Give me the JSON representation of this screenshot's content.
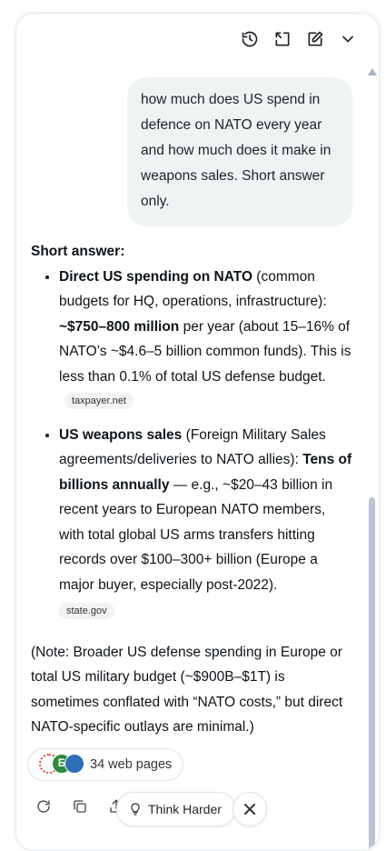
{
  "user_message": "how much does US spend in defence on NATO every year and how much does it make in weapons sales. Short answer only.",
  "answer": {
    "heading": "Short answer:",
    "items": [
      {
        "title": "Direct US spending on NATO",
        "desc": " (common budgets for HQ, operations, infrastructure): ",
        "highlight": "~$750–800 million",
        "rest": " per year (about 15–16% of NATO’s ~$4.6–5 billion common funds). This is less than 0.1% of total US defense budget.",
        "source": "taxpayer.net"
      },
      {
        "title": "US weapons sales",
        "desc": " (Foreign Military Sales agreements/deliveries to NATO allies): ",
        "highlight": "Tens of billions annually",
        "rest": " — e.g., ~$20–43 billion in recent years to European NATO members, with total global US arms transfers hitting records over $100–300+ billion (Europe a major buyer, especially post-2022).",
        "source": "state.gov"
      }
    ],
    "note": "(Note: Broader US defense spending in Europe or total US military budget (~$900B–$1T) is sometimes conflated with “NATO costs,” but direct NATO-specific outlays are minimal.)"
  },
  "sources_pill": {
    "label": "34 web pages"
  },
  "think_button": {
    "label": "Think Harder"
  },
  "icons": {
    "toolbar": [
      "history-icon",
      "expand-icon",
      "edit-icon",
      "chevron-down-icon"
    ],
    "actions": [
      "regenerate-icon",
      "copy-icon",
      "share-icon"
    ]
  }
}
